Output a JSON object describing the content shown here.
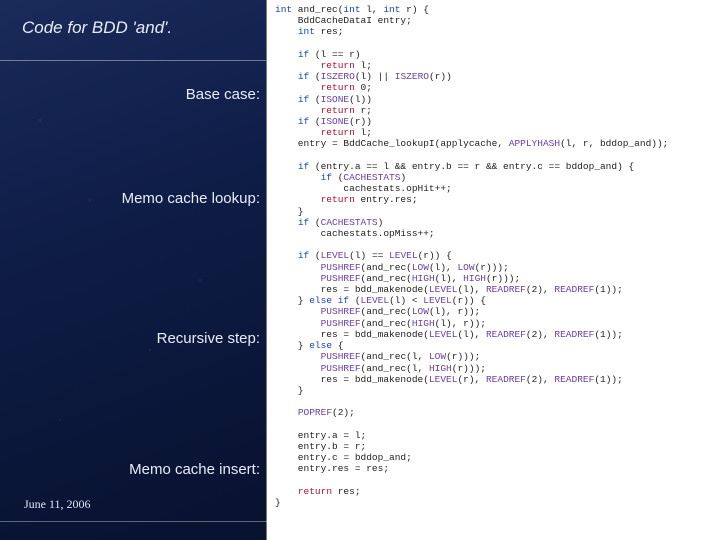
{
  "title": "Code for BDD 'and'.",
  "labels": {
    "base": "Base case:",
    "lookup": "Memo cache lookup:",
    "recursive": "Recursive step:",
    "insert": "Memo cache insert:"
  },
  "date": "June 11, 2006",
  "code": "int and_rec(int l, int r) {\n    BddCacheDataI entry;\n    int res;\n\n    if (l == r)\n        return l;\n    if (ISZERO(l) || ISZERO(r))\n        return 0;\n    if (ISONE(l))\n        return r;\n    if (ISONE(r))\n        return l;\n    entry = BddCache_lookupI(applycache, APPLYHASH(l, r, bddop_and));\n\n    if (entry.a == l && entry.b == r && entry.c == bddop_and) {\n        if (CACHESTATS)\n            cachestats.opHit++;\n        return entry.res;\n    }\n    if (CACHESTATS)\n        cachestats.opMiss++;\n\n    if (LEVEL(l) == LEVEL(r)) {\n        PUSHREF(and_rec(LOW(l), LOW(r)));\n        PUSHREF(and_rec(HIGH(l), HIGH(r)));\n        res = bdd_makenode(LEVEL(l), READREF(2), READREF(1));\n    } else if (LEVEL(l) < LEVEL(r)) {\n        PUSHREF(and_rec(LOW(l), r));\n        PUSHREF(and_rec(HIGH(l), r));\n        res = bdd_makenode(LEVEL(l), READREF(2), READREF(1));\n    } else {\n        PUSHREF(and_rec(l, LOW(r)));\n        PUSHREF(and_rec(l, HIGH(r)));\n        res = bdd_makenode(LEVEL(r), READREF(2), READREF(1));\n    }\n\n    POPREF(2);\n\n    entry.a = l;\n    entry.b = r;\n    entry.c = bddop_and;\n    entry.res = res;\n\n    return res;\n}"
}
